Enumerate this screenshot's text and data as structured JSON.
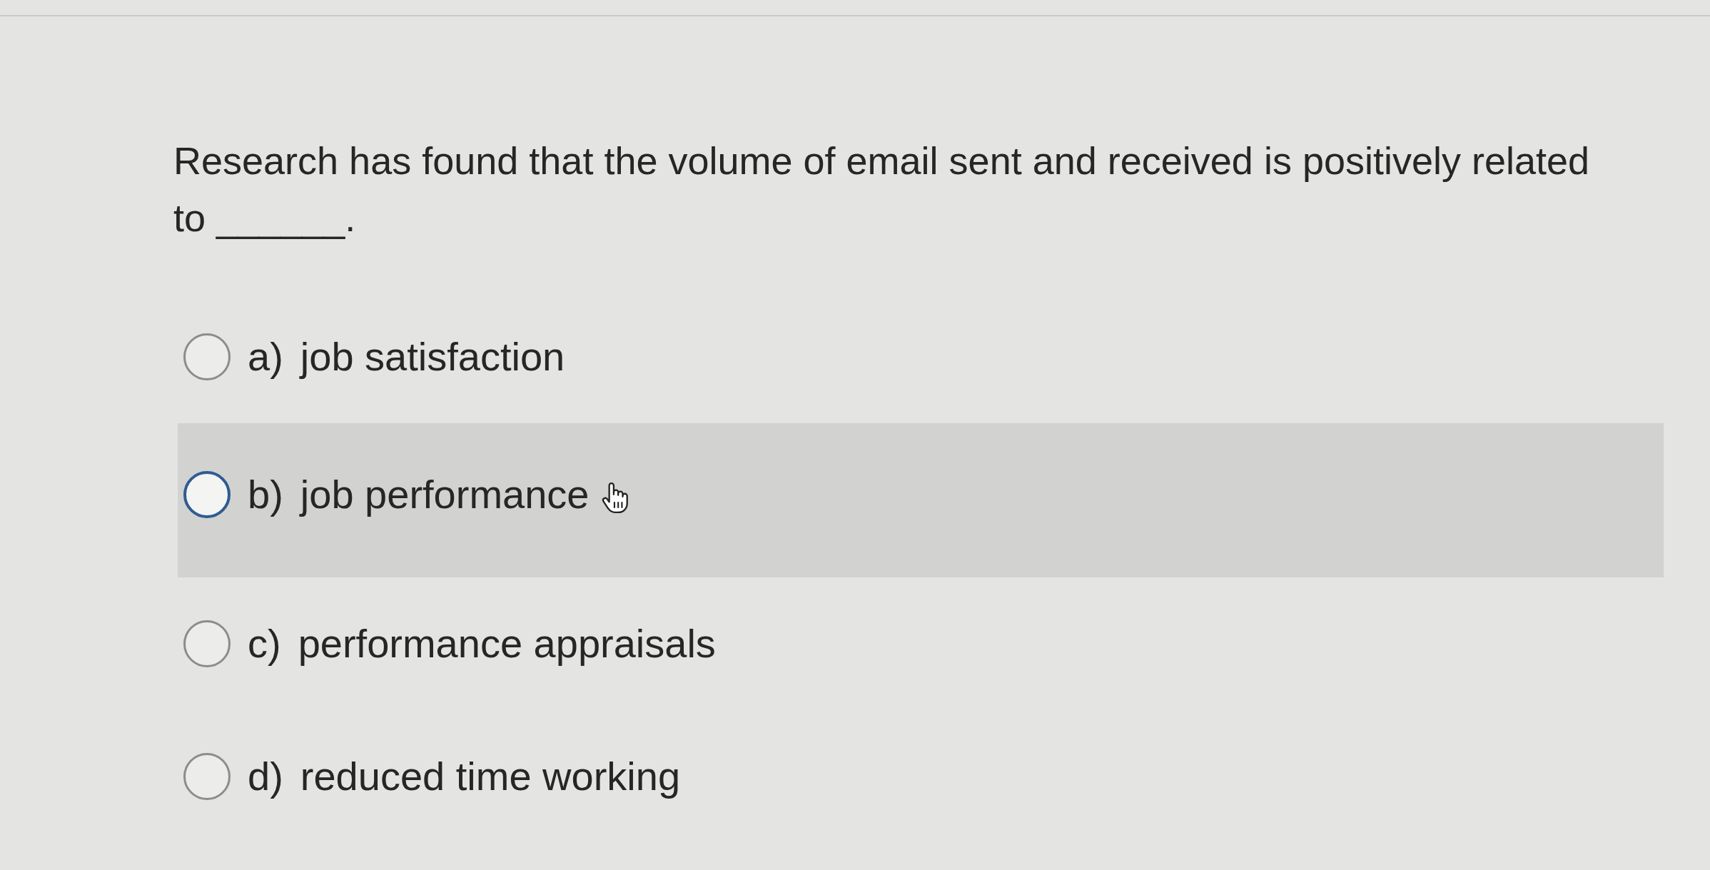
{
  "question": {
    "text": "Research has found that the volume of email sent and received is positively related to ______."
  },
  "options": [
    {
      "letter": "a)",
      "label": "job satisfaction",
      "selected": false,
      "hovered": false
    },
    {
      "letter": "b)",
      "label": "job performance",
      "selected": false,
      "hovered": true
    },
    {
      "letter": "c)",
      "label": "performance appraisals",
      "selected": false,
      "hovered": false
    },
    {
      "letter": "d)",
      "label": "reduced time working",
      "selected": false,
      "hovered": false
    }
  ]
}
